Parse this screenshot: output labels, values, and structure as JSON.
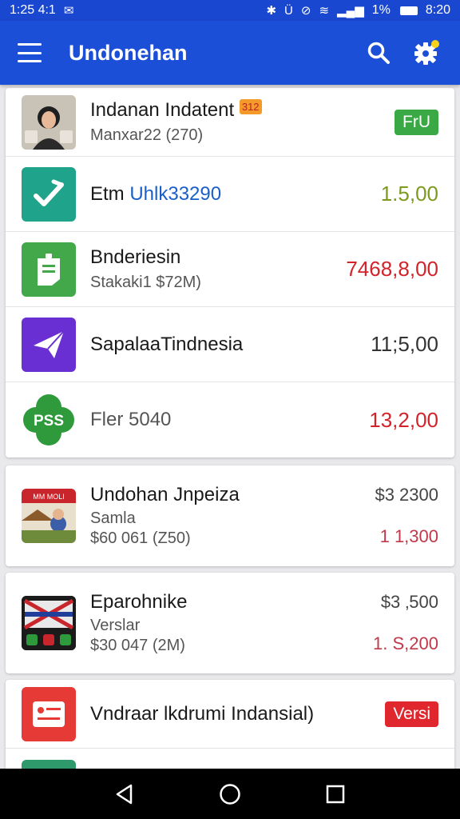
{
  "status_bar": {
    "time_left": "1:25 4:1",
    "notif_glyph": "✉",
    "bluetooth": "✱",
    "vibrate": "Ü",
    "dnd": "⊘",
    "wifi": "≋",
    "signal": "▂▄▆",
    "battery_text": "1%",
    "clock_right": "8:20"
  },
  "app_bar": {
    "title": "Undonehan"
  },
  "list1": [
    {
      "title": "Indanan Indatent",
      "subtitle": "Manxar22 (270)",
      "badge": "FrU",
      "badge_color": "#3aa845",
      "tile_color": "#d8d0c8",
      "tile_tag": "312"
    },
    {
      "title_a": "Etm ",
      "title_b": "Uhlk33290",
      "amount": "1.5,00",
      "amount_color": "#7c9a1e",
      "tile_color": "#1fa38a"
    },
    {
      "title": "Bnderiesin",
      "subtitle": "Stakaki1 $72M)",
      "amount": "7468,8,00",
      "amount_color": "#d2232a",
      "tile_color": "#43a84a"
    },
    {
      "title": "SapalaaTindnesia",
      "amount": "11;5,00",
      "amount_color": "#333333",
      "tile_color": "#6a2fd3"
    },
    {
      "title": "Fler 5040",
      "amount": "13,2,00",
      "amount_color": "#d2232a",
      "tile_color": "#2e9a3b",
      "tile_text": "PSS"
    }
  ],
  "card2": {
    "title": "Undohan Jnpeiza",
    "line2": "Samla",
    "line3": "$60 061 (Z50)",
    "amount_top": "$3 2300",
    "amount_bottom": "1 1,300",
    "tile_tag": "MM MOLI"
  },
  "card3": {
    "title": "Eparohnike",
    "line2": "Verslar",
    "line3": "$30 047 (2M)",
    "amount_top": "$3 ‚500",
    "amount_bottom": "1. S,200"
  },
  "card4": {
    "title": "Vndraar lkdrumi Indansial)",
    "badge": "Versi",
    "badge_color": "#e0272e",
    "tile_color": "#e53a36"
  },
  "nav": {
    "back_icon": "back-icon",
    "home_icon": "home-icon",
    "recents_icon": "recents-icon"
  }
}
